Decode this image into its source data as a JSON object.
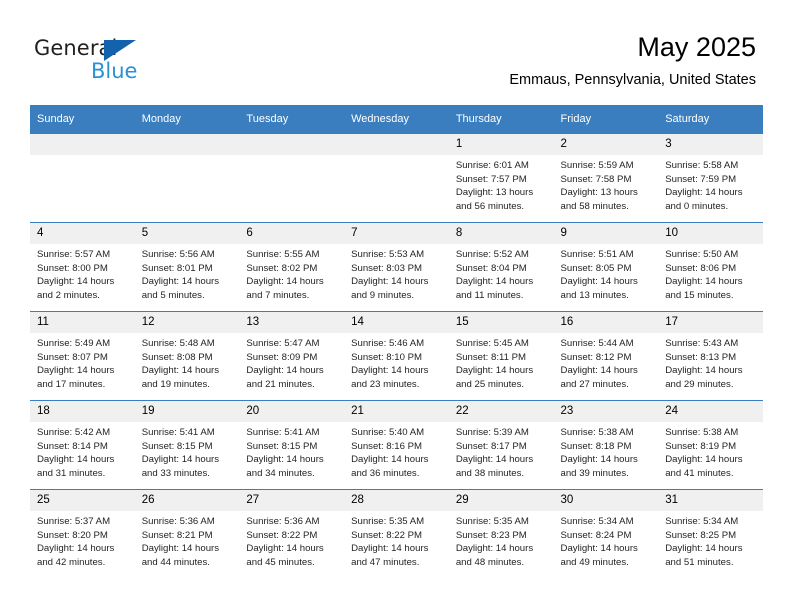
{
  "logo": {
    "word_top": "General",
    "word_bottom": "Blue",
    "triangle_color": "#1362ad",
    "blue_color": "#2a92d4"
  },
  "header": {
    "title": "May 2025",
    "subtitle": "Emmaus, Pennsylvania, United States"
  },
  "theme": {
    "header_row_bg": "#3a7ebf",
    "daynum_bg": "#f0f0f0",
    "row_divider": "#3a7ebf"
  },
  "weekdays": [
    "Sunday",
    "Monday",
    "Tuesday",
    "Wednesday",
    "Thursday",
    "Friday",
    "Saturday"
  ],
  "weeks": [
    [
      {
        "day": "",
        "empty": true
      },
      {
        "day": "",
        "empty": true
      },
      {
        "day": "",
        "empty": true
      },
      {
        "day": "",
        "empty": true
      },
      {
        "day": "1",
        "sunrise": "Sunrise: 6:01 AM",
        "sunset": "Sunset: 7:57 PM",
        "daylight1": "Daylight: 13 hours",
        "daylight2": "and 56 minutes."
      },
      {
        "day": "2",
        "sunrise": "Sunrise: 5:59 AM",
        "sunset": "Sunset: 7:58 PM",
        "daylight1": "Daylight: 13 hours",
        "daylight2": "and 58 minutes."
      },
      {
        "day": "3",
        "sunrise": "Sunrise: 5:58 AM",
        "sunset": "Sunset: 7:59 PM",
        "daylight1": "Daylight: 14 hours",
        "daylight2": "and 0 minutes."
      }
    ],
    [
      {
        "day": "4",
        "sunrise": "Sunrise: 5:57 AM",
        "sunset": "Sunset: 8:00 PM",
        "daylight1": "Daylight: 14 hours",
        "daylight2": "and 2 minutes."
      },
      {
        "day": "5",
        "sunrise": "Sunrise: 5:56 AM",
        "sunset": "Sunset: 8:01 PM",
        "daylight1": "Daylight: 14 hours",
        "daylight2": "and 5 minutes."
      },
      {
        "day": "6",
        "sunrise": "Sunrise: 5:55 AM",
        "sunset": "Sunset: 8:02 PM",
        "daylight1": "Daylight: 14 hours",
        "daylight2": "and 7 minutes."
      },
      {
        "day": "7",
        "sunrise": "Sunrise: 5:53 AM",
        "sunset": "Sunset: 8:03 PM",
        "daylight1": "Daylight: 14 hours",
        "daylight2": "and 9 minutes."
      },
      {
        "day": "8",
        "sunrise": "Sunrise: 5:52 AM",
        "sunset": "Sunset: 8:04 PM",
        "daylight1": "Daylight: 14 hours",
        "daylight2": "and 11 minutes."
      },
      {
        "day": "9",
        "sunrise": "Sunrise: 5:51 AM",
        "sunset": "Sunset: 8:05 PM",
        "daylight1": "Daylight: 14 hours",
        "daylight2": "and 13 minutes."
      },
      {
        "day": "10",
        "sunrise": "Sunrise: 5:50 AM",
        "sunset": "Sunset: 8:06 PM",
        "daylight1": "Daylight: 14 hours",
        "daylight2": "and 15 minutes."
      }
    ],
    [
      {
        "day": "11",
        "sunrise": "Sunrise: 5:49 AM",
        "sunset": "Sunset: 8:07 PM",
        "daylight1": "Daylight: 14 hours",
        "daylight2": "and 17 minutes."
      },
      {
        "day": "12",
        "sunrise": "Sunrise: 5:48 AM",
        "sunset": "Sunset: 8:08 PM",
        "daylight1": "Daylight: 14 hours",
        "daylight2": "and 19 minutes."
      },
      {
        "day": "13",
        "sunrise": "Sunrise: 5:47 AM",
        "sunset": "Sunset: 8:09 PM",
        "daylight1": "Daylight: 14 hours",
        "daylight2": "and 21 minutes."
      },
      {
        "day": "14",
        "sunrise": "Sunrise: 5:46 AM",
        "sunset": "Sunset: 8:10 PM",
        "daylight1": "Daylight: 14 hours",
        "daylight2": "and 23 minutes."
      },
      {
        "day": "15",
        "sunrise": "Sunrise: 5:45 AM",
        "sunset": "Sunset: 8:11 PM",
        "daylight1": "Daylight: 14 hours",
        "daylight2": "and 25 minutes."
      },
      {
        "day": "16",
        "sunrise": "Sunrise: 5:44 AM",
        "sunset": "Sunset: 8:12 PM",
        "daylight1": "Daylight: 14 hours",
        "daylight2": "and 27 minutes."
      },
      {
        "day": "17",
        "sunrise": "Sunrise: 5:43 AM",
        "sunset": "Sunset: 8:13 PM",
        "daylight1": "Daylight: 14 hours",
        "daylight2": "and 29 minutes."
      }
    ],
    [
      {
        "day": "18",
        "sunrise": "Sunrise: 5:42 AM",
        "sunset": "Sunset: 8:14 PM",
        "daylight1": "Daylight: 14 hours",
        "daylight2": "and 31 minutes."
      },
      {
        "day": "19",
        "sunrise": "Sunrise: 5:41 AM",
        "sunset": "Sunset: 8:15 PM",
        "daylight1": "Daylight: 14 hours",
        "daylight2": "and 33 minutes."
      },
      {
        "day": "20",
        "sunrise": "Sunrise: 5:41 AM",
        "sunset": "Sunset: 8:15 PM",
        "daylight1": "Daylight: 14 hours",
        "daylight2": "and 34 minutes."
      },
      {
        "day": "21",
        "sunrise": "Sunrise: 5:40 AM",
        "sunset": "Sunset: 8:16 PM",
        "daylight1": "Daylight: 14 hours",
        "daylight2": "and 36 minutes."
      },
      {
        "day": "22",
        "sunrise": "Sunrise: 5:39 AM",
        "sunset": "Sunset: 8:17 PM",
        "daylight1": "Daylight: 14 hours",
        "daylight2": "and 38 minutes."
      },
      {
        "day": "23",
        "sunrise": "Sunrise: 5:38 AM",
        "sunset": "Sunset: 8:18 PM",
        "daylight1": "Daylight: 14 hours",
        "daylight2": "and 39 minutes."
      },
      {
        "day": "24",
        "sunrise": "Sunrise: 5:38 AM",
        "sunset": "Sunset: 8:19 PM",
        "daylight1": "Daylight: 14 hours",
        "daylight2": "and 41 minutes."
      }
    ],
    [
      {
        "day": "25",
        "sunrise": "Sunrise: 5:37 AM",
        "sunset": "Sunset: 8:20 PM",
        "daylight1": "Daylight: 14 hours",
        "daylight2": "and 42 minutes."
      },
      {
        "day": "26",
        "sunrise": "Sunrise: 5:36 AM",
        "sunset": "Sunset: 8:21 PM",
        "daylight1": "Daylight: 14 hours",
        "daylight2": "and 44 minutes."
      },
      {
        "day": "27",
        "sunrise": "Sunrise: 5:36 AM",
        "sunset": "Sunset: 8:22 PM",
        "daylight1": "Daylight: 14 hours",
        "daylight2": "and 45 minutes."
      },
      {
        "day": "28",
        "sunrise": "Sunrise: 5:35 AM",
        "sunset": "Sunset: 8:22 PM",
        "daylight1": "Daylight: 14 hours",
        "daylight2": "and 47 minutes."
      },
      {
        "day": "29",
        "sunrise": "Sunrise: 5:35 AM",
        "sunset": "Sunset: 8:23 PM",
        "daylight1": "Daylight: 14 hours",
        "daylight2": "and 48 minutes."
      },
      {
        "day": "30",
        "sunrise": "Sunrise: 5:34 AM",
        "sunset": "Sunset: 8:24 PM",
        "daylight1": "Daylight: 14 hours",
        "daylight2": "and 49 minutes."
      },
      {
        "day": "31",
        "sunrise": "Sunrise: 5:34 AM",
        "sunset": "Sunset: 8:25 PM",
        "daylight1": "Daylight: 14 hours",
        "daylight2": "and 51 minutes."
      }
    ]
  ]
}
